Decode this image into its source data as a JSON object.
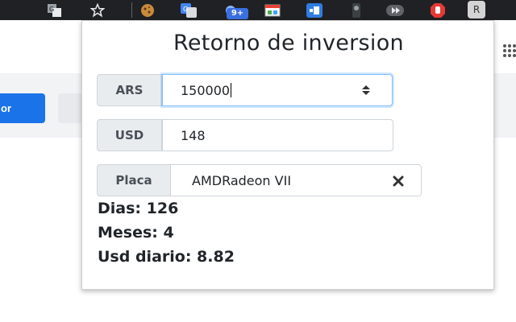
{
  "popup": {
    "title": "Retorno de inversion",
    "ars": {
      "label": "ARS",
      "value": "150000"
    },
    "usd": {
      "label": "USD",
      "value": "148"
    },
    "placa": {
      "label": "Placa",
      "value": "AMDRadeon VII"
    },
    "results": {
      "dias": "Dias: 126",
      "meses": "Meses: 4",
      "usd_diario": "Usd diario: 8.82"
    }
  },
  "toolbar": {
    "extension_badge": "9+",
    "profile_initial": "R"
  },
  "background": {
    "button_label": "or"
  }
}
